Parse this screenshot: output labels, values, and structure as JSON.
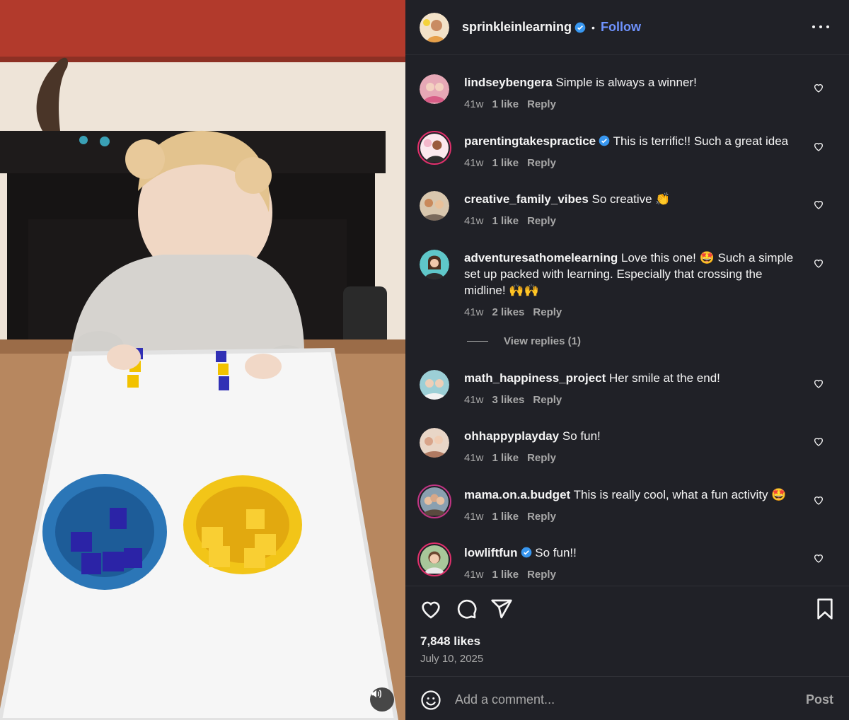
{
  "post": {
    "author": "sprinkleinlearning",
    "follow_label": "Follow",
    "separator": "•",
    "likes": "7,848 likes",
    "date": "July 10, 2025"
  },
  "comments": [
    {
      "user": "lindseybengera",
      "verified": false,
      "text": "Simple is always a winner!",
      "time": "41w",
      "likes": "1 like",
      "reply": "Reply"
    },
    {
      "user": "parentingtakespractice",
      "verified": true,
      "text": "This is terrific!! Such a great idea",
      "time": "41w",
      "likes": "1 like",
      "reply": "Reply"
    },
    {
      "user": "creative_family_vibes",
      "verified": false,
      "text": "So creative 👏",
      "time": "41w",
      "likes": "1 like",
      "reply": "Reply"
    },
    {
      "user": "adventuresathomelearning",
      "verified": false,
      "text": "Love this one! 🤩 Such a simple set up packed with learning. Especially that crossing the midline! 🙌🙌",
      "time": "41w",
      "likes": "2 likes",
      "reply": "Reply",
      "view_replies": "View replies (1)"
    },
    {
      "user": "math_happiness_project",
      "verified": false,
      "text": "Her smile at the end!",
      "time": "41w",
      "likes": "3 likes",
      "reply": "Reply"
    },
    {
      "user": "ohhappyplayday",
      "verified": false,
      "text": "So fun!",
      "time": "41w",
      "likes": "1 like",
      "reply": "Reply"
    },
    {
      "user": "mama.on.a.budget",
      "verified": false,
      "text": "This is really cool, what a fun activity 🤩",
      "time": "41w",
      "likes": "1 like",
      "reply": "Reply"
    },
    {
      "user": "lowliftfun",
      "verified": true,
      "text": "So fun!!",
      "time": "41w",
      "likes": "1 like",
      "reply": "Reply"
    }
  ],
  "add_comment": {
    "placeholder": "Add a comment...",
    "post_label": "Post"
  },
  "colors": {
    "panel_bg": "#202127",
    "link_blue": "#6f93ff",
    "muted": "#a8a8a8"
  }
}
